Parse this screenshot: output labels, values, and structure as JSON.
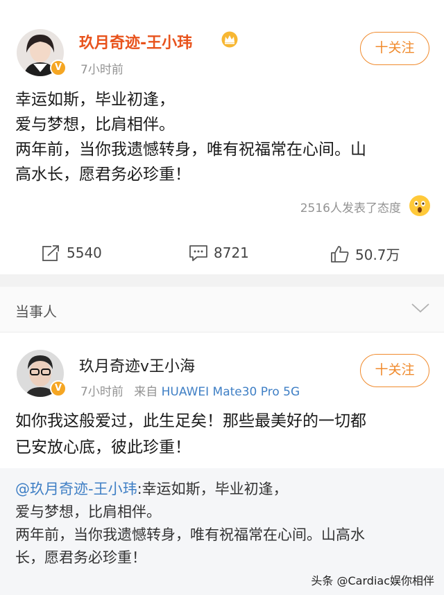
{
  "post1": {
    "name": "玖月奇迹-王小玮",
    "time": "7小时前",
    "follow_label": "十关注",
    "text": "幸运如斯，毕业初逢，\n爱与梦想，比肩相伴。\n两年前，当你我遗憾转身，唯有祝福常在心间。山\n高水长，愿君务必珍重！",
    "reactions_text": "2516人发表了态度",
    "repost_count": "5540",
    "comment_count": "8721",
    "like_count": "50.7万",
    "icons": {
      "crown": "crown-icon",
      "verified": "verified-v-icon",
      "reaction": "surprised-emoji-icon"
    }
  },
  "section": {
    "title": "当事人"
  },
  "post2": {
    "name": "玖月奇迹v王小海",
    "time": "7小时前",
    "source_prefix": "来自",
    "source": "HUAWEI Mate30 Pro 5G",
    "follow_label": "十关注",
    "text": "如你我这般爱过，此生足矣！那些最美好的一切都\n已安放心底，彼此珍重！",
    "quote_mention": "@玖月奇迹-王小玮",
    "quote_text": ":幸运如斯，毕业初逢，\n爱与梦想，比肩相伴。\n两年前，当你我遗憾转身，唯有祝福常在心间。山高水\n长，愿君务必珍重！"
  },
  "watermark": "头条 @Cardiac娱你相伴",
  "colors": {
    "accent": "#f08a2c",
    "link": "#3f7fc5",
    "verified": "#f5a623",
    "muted": "#939393"
  }
}
